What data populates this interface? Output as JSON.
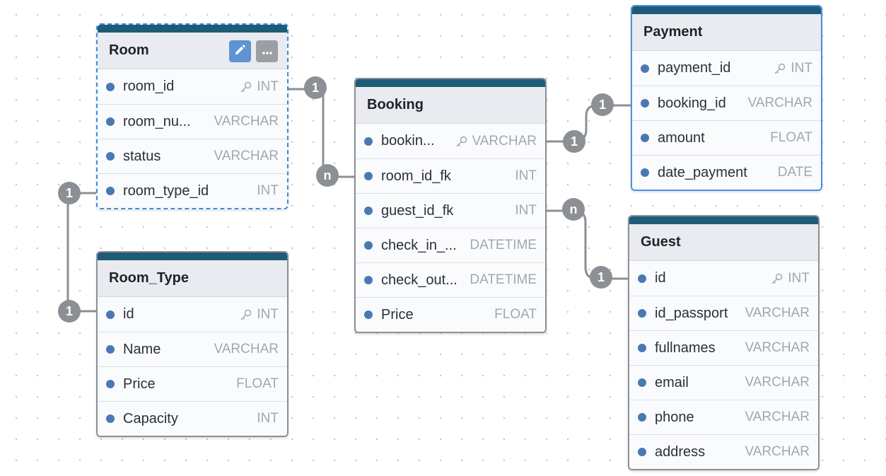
{
  "tables": {
    "room": {
      "title": "Room",
      "fields": [
        {
          "name": "room_id",
          "type": "INT",
          "key": true
        },
        {
          "name": "room_nu...",
          "type": "VARCHAR",
          "key": false
        },
        {
          "name": "status",
          "type": "VARCHAR",
          "key": false
        },
        {
          "name": "room_type_id",
          "type": "INT",
          "key": false
        }
      ],
      "actions": [
        "pencil-icon",
        "more-icon"
      ]
    },
    "room_type": {
      "title": "Room_Type",
      "fields": [
        {
          "name": "id",
          "type": "INT",
          "key": true
        },
        {
          "name": "Name",
          "type": "VARCHAR",
          "key": false
        },
        {
          "name": "Price",
          "type": "FLOAT",
          "key": false
        },
        {
          "name": "Capacity",
          "type": "INT",
          "key": false
        }
      ]
    },
    "booking": {
      "title": "Booking",
      "fields": [
        {
          "name": "bookin...",
          "type": "VARCHAR",
          "key": true
        },
        {
          "name": "room_id_fk",
          "type": "INT",
          "key": false
        },
        {
          "name": "guest_id_fk",
          "type": "INT",
          "key": false
        },
        {
          "name": "check_in_...",
          "type": "DATETIME",
          "key": false
        },
        {
          "name": "check_out...",
          "type": "DATETIME",
          "key": false
        },
        {
          "name": "Price",
          "type": "FLOAT",
          "key": false
        }
      ]
    },
    "payment": {
      "title": "Payment",
      "fields": [
        {
          "name": "payment_id",
          "type": "INT",
          "key": true
        },
        {
          "name": "booking_id",
          "type": "VARCHAR",
          "key": false
        },
        {
          "name": "amount",
          "type": "FLOAT",
          "key": false
        },
        {
          "name": "date_payment",
          "type": "DATE",
          "key": false
        }
      ]
    },
    "guest": {
      "title": "Guest",
      "fields": [
        {
          "name": "id",
          "type": "INT",
          "key": true
        },
        {
          "name": "id_passport",
          "type": "VARCHAR",
          "key": false
        },
        {
          "name": "fullnames",
          "type": "VARCHAR",
          "key": false
        },
        {
          "name": "email",
          "type": "VARCHAR",
          "key": false
        },
        {
          "name": "phone",
          "type": "VARCHAR",
          "key": false
        },
        {
          "name": "address",
          "type": "VARCHAR",
          "key": false
        }
      ]
    }
  },
  "relationships": [
    {
      "from": "room.room_id",
      "from_card": "1",
      "to": "booking.room_id_fk",
      "to_card": "n"
    },
    {
      "from": "room_type.id",
      "from_card": "1",
      "to": "room.room_type_id",
      "to_card": "1"
    },
    {
      "from": "booking.booking_id",
      "from_card": "1",
      "to": "payment.booking_id",
      "to_card": "1"
    },
    {
      "from": "booking.guest_id_fk",
      "from_card": "n",
      "to": "guest.id",
      "to_card": "1"
    }
  ],
  "colors": {
    "header_bar": "#1e5b78",
    "field_dot": "#4a78b3",
    "badge": "#8c8f94",
    "selection": "#4a90e2"
  }
}
